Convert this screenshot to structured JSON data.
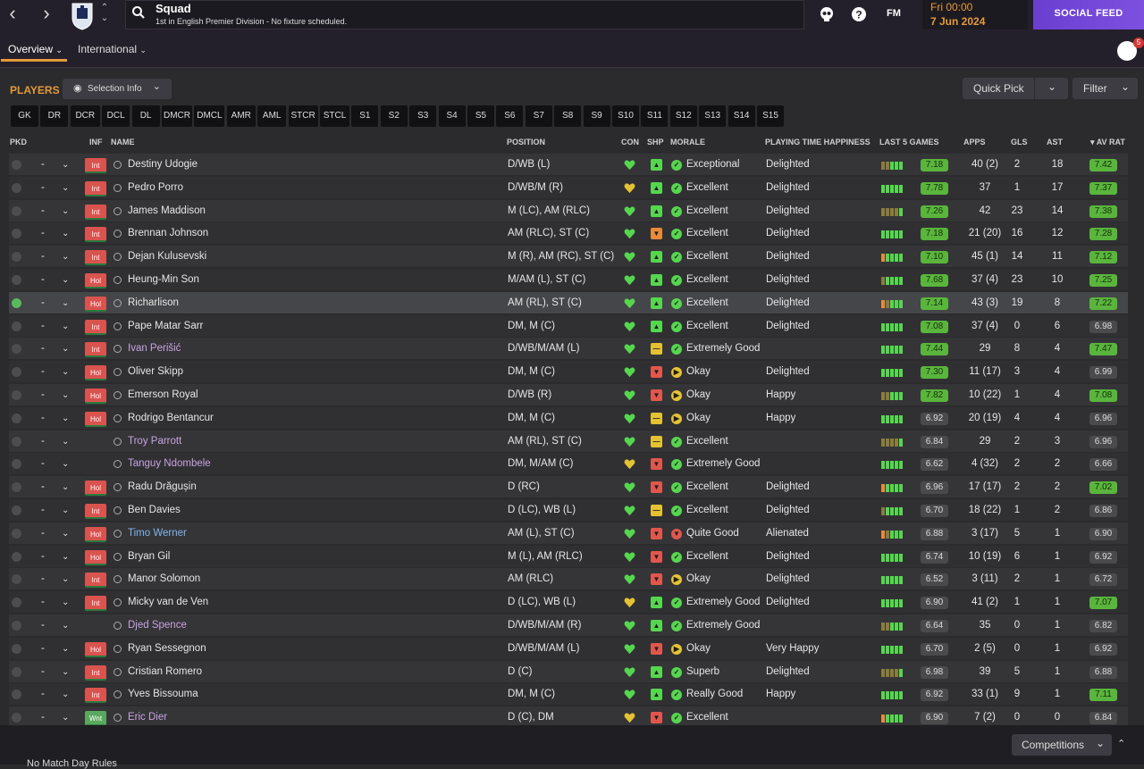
{
  "header": {
    "title": "Squad",
    "subtitle": "1st in English Premier Division - No fixture scheduled.",
    "day_time": "Fri 00:00",
    "date": "7 Jun 2024",
    "social_feed": "SOCIAL FEED",
    "fm_label": "FM",
    "notification_count": "5",
    "back": "‹",
    "forward": "›",
    "up": "⌃",
    "down": "⌄"
  },
  "subnav": {
    "overview": "Overview",
    "international": "International"
  },
  "toolbar": {
    "players_label": "PLAYERS",
    "selection_info": "Selection Info",
    "quick_pick": "Quick Pick",
    "filter": "Filter"
  },
  "position_filters": [
    "GK",
    "DR",
    "DCR",
    "DCL",
    "DL",
    "DMCR",
    "DMCL",
    "AMR",
    "AML",
    "STCR",
    "STCL",
    "S1",
    "S2",
    "S3",
    "S4",
    "S5",
    "S6",
    "S7",
    "S8",
    "S9",
    "S10",
    "S11",
    "S12",
    "S13",
    "S14",
    "S15"
  ],
  "columns": {
    "pkd": "PKD",
    "inf": "INF",
    "name": "NAME",
    "position": "POSITION",
    "con": "CON",
    "shp": "SHP",
    "morale": "MORALE",
    "pth": "PLAYING TIME HAPPINESS",
    "last5": "LAST 5 GAMES",
    "apps": "APPS",
    "gls": "GLS",
    "ast": "AST",
    "avrat": "AV RAT"
  },
  "players": [
    {
      "name": "Destiny Udogie",
      "inf": "Int",
      "pos": "D/WB (L)",
      "con": "green",
      "shp": "green",
      "morale": "Exceptional",
      "mor": "green",
      "pth": "Delighted",
      "l5": "7.18",
      "l5g": true,
      "apps": "40 (2)",
      "gls": "2",
      "ast": "18",
      "avr": "7.42",
      "avrg": true
    },
    {
      "name": "Pedro Porro",
      "inf": "Int",
      "pos": "D/WB/M (R)",
      "con": "yellow",
      "shp": "green",
      "morale": "Excellent",
      "mor": "green",
      "pth": "Delighted",
      "l5": "7.78",
      "l5g": true,
      "apps": "37",
      "gls": "1",
      "ast": "17",
      "avr": "7.37",
      "avrg": true
    },
    {
      "name": "James Maddison",
      "inf": "Int",
      "pos": "M (LC), AM (RLC)",
      "con": "green",
      "shp": "green",
      "morale": "Excellent",
      "mor": "green",
      "pth": "Delighted",
      "l5": "7.26",
      "l5g": true,
      "apps": "42",
      "gls": "23",
      "ast": "14",
      "avr": "7.38",
      "avrg": true
    },
    {
      "name": "Brennan Johnson",
      "inf": "Int",
      "pos": "AM (RLC), ST (C)",
      "con": "green",
      "shp": "orange",
      "morale": "Excellent",
      "mor": "green",
      "pth": "Delighted",
      "l5": "7.18",
      "l5g": true,
      "apps": "21 (20)",
      "gls": "16",
      "ast": "12",
      "avr": "7.28",
      "avrg": true
    },
    {
      "name": "Dejan Kulusevski",
      "inf": "Int",
      "pos": "M (R), AM (RC), ST (C)",
      "con": "green",
      "shp": "green",
      "morale": "Excellent",
      "mor": "green",
      "pth": "Delighted",
      "l5": "7.10",
      "l5g": true,
      "apps": "45 (1)",
      "gls": "14",
      "ast": "11",
      "avr": "7.12",
      "avrg": true
    },
    {
      "name": "Heung-Min Son",
      "inf": "Hol",
      "pos": "M/AM (L), ST (C)",
      "con": "green",
      "shp": "green",
      "morale": "Excellent",
      "mor": "green",
      "pth": "Delighted",
      "l5": "7.68",
      "l5g": true,
      "apps": "37 (4)",
      "gls": "23",
      "ast": "10",
      "avr": "7.25",
      "avrg": true
    },
    {
      "name": "Richarlison",
      "inf": "Hol",
      "pos": "AM (RL), ST (C)",
      "con": "green",
      "shp": "green",
      "morale": "Excellent",
      "mor": "green",
      "pth": "Delighted",
      "l5": "7.14",
      "l5g": true,
      "apps": "43 (3)",
      "gls": "19",
      "ast": "8",
      "avr": "7.22",
      "avrg": true,
      "selected": true
    },
    {
      "name": "Pape Matar Sarr",
      "inf": "Int",
      "pos": "DM, M (C)",
      "con": "green",
      "shp": "green",
      "morale": "Excellent",
      "mor": "green",
      "pth": "Delighted",
      "l5": "7.08",
      "l5g": true,
      "apps": "37 (4)",
      "gls": "0",
      "ast": "6",
      "avr": "6.98",
      "avrg": false
    },
    {
      "name": "Ivan Perišić",
      "inf": "Int",
      "pos": "D/WB/M/AM (L)",
      "con": "green",
      "shp": "yellow",
      "morale": "Extremely Good",
      "mor": "green",
      "pth": "",
      "l5": "7.44",
      "l5g": true,
      "apps": "29",
      "gls": "8",
      "ast": "4",
      "avr": "7.47",
      "avrg": true,
      "color": "purple"
    },
    {
      "name": "Oliver Skipp",
      "inf": "Hol",
      "pos": "DM, M (C)",
      "con": "green",
      "shp": "red",
      "morale": "Okay",
      "mor": "yellow",
      "pth": "Delighted",
      "l5": "7.30",
      "l5g": true,
      "apps": "11 (17)",
      "gls": "3",
      "ast": "4",
      "avr": "6.99",
      "avrg": false
    },
    {
      "name": "Emerson Royal",
      "inf": "Hol",
      "pos": "D/WB (R)",
      "con": "green",
      "shp": "red",
      "morale": "Okay",
      "mor": "yellow",
      "pth": "Happy",
      "l5": "7.82",
      "l5g": true,
      "apps": "10 (22)",
      "gls": "1",
      "ast": "4",
      "avr": "7.08",
      "avrg": true
    },
    {
      "name": "Rodrigo Bentancur",
      "inf": "Hol",
      "pos": "DM, M (C)",
      "con": "green",
      "shp": "yellow",
      "morale": "Okay",
      "mor": "yellow",
      "pth": "Happy",
      "l5": "6.92",
      "l5g": false,
      "apps": "20 (19)",
      "gls": "4",
      "ast": "4",
      "avr": "6.96",
      "avrg": false
    },
    {
      "name": "Troy Parrott",
      "inf": "",
      "pos": "AM (RL), ST (C)",
      "con": "green",
      "shp": "yellow",
      "morale": "Excellent",
      "mor": "green",
      "pth": "",
      "l5": "6.84",
      "l5g": false,
      "apps": "29",
      "gls": "2",
      "ast": "3",
      "avr": "6.96",
      "avrg": false,
      "color": "purple"
    },
    {
      "name": "Tanguy Ndombele",
      "inf": "",
      "pos": "DM, M/AM (C)",
      "con": "yellow",
      "shp": "red",
      "morale": "Extremely Good",
      "mor": "green",
      "pth": "",
      "l5": "6.62",
      "l5g": false,
      "apps": "4 (32)",
      "gls": "2",
      "ast": "2",
      "avr": "6.66",
      "avrg": false,
      "color": "purple"
    },
    {
      "name": "Radu Drăgușin",
      "inf": "Hol",
      "pos": "D (RC)",
      "con": "green",
      "shp": "red",
      "morale": "Excellent",
      "mor": "green",
      "pth": "Delighted",
      "l5": "6.96",
      "l5g": false,
      "apps": "17 (17)",
      "gls": "2",
      "ast": "2",
      "avr": "7.02",
      "avrg": true
    },
    {
      "name": "Ben Davies",
      "inf": "Int",
      "pos": "D (LC), WB (L)",
      "con": "green",
      "shp": "yellow",
      "morale": "Excellent",
      "mor": "green",
      "pth": "Delighted",
      "l5": "6.70",
      "l5g": false,
      "apps": "18 (22)",
      "gls": "1",
      "ast": "2",
      "avr": "6.86",
      "avrg": false
    },
    {
      "name": "Timo Werner",
      "inf": "Hol",
      "pos": "AM (L), ST (C)",
      "con": "green",
      "shp": "red",
      "morale": "Quite Good",
      "mor": "red",
      "pth": "Alienated",
      "l5": "6.88",
      "l5g": false,
      "apps": "3 (17)",
      "gls": "5",
      "ast": "1",
      "avr": "6.90",
      "avrg": false,
      "color": "blue"
    },
    {
      "name": "Bryan Gil",
      "inf": "Hol",
      "pos": "M (L), AM (RLC)",
      "con": "green",
      "shp": "red",
      "morale": "Excellent",
      "mor": "green",
      "pth": "Delighted",
      "l5": "6.74",
      "l5g": false,
      "apps": "10 (19)",
      "gls": "6",
      "ast": "1",
      "avr": "6.92",
      "avrg": false
    },
    {
      "name": "Manor Solomon",
      "inf": "Int",
      "pos": "AM (RLC)",
      "con": "green",
      "shp": "red",
      "morale": "Okay",
      "mor": "yellow",
      "pth": "Delighted",
      "l5": "6.52",
      "l5g": false,
      "apps": "3 (11)",
      "gls": "2",
      "ast": "1",
      "avr": "6.72",
      "avrg": false
    },
    {
      "name": "Micky van de Ven",
      "inf": "Int",
      "pos": "D (LC), WB (L)",
      "con": "yellow",
      "shp": "green",
      "morale": "Extremely Good",
      "mor": "green",
      "pth": "Delighted",
      "l5": "6.90",
      "l5g": false,
      "apps": "41 (2)",
      "gls": "1",
      "ast": "1",
      "avr": "7.07",
      "avrg": true
    },
    {
      "name": "Djed Spence",
      "inf": "",
      "pos": "D/WB/M/AM (R)",
      "con": "green",
      "shp": "green",
      "morale": "Extremely Good",
      "mor": "green",
      "pth": "",
      "l5": "6.64",
      "l5g": false,
      "apps": "35",
      "gls": "0",
      "ast": "1",
      "avr": "6.82",
      "avrg": false,
      "color": "purple"
    },
    {
      "name": "Ryan Sessegnon",
      "inf": "Hol",
      "pos": "D/WB/M/AM (L)",
      "con": "green",
      "shp": "red",
      "morale": "Okay",
      "mor": "yellow",
      "pth": "Very Happy",
      "l5": "6.70",
      "l5g": false,
      "apps": "2 (5)",
      "gls": "0",
      "ast": "1",
      "avr": "6.92",
      "avrg": false
    },
    {
      "name": "Cristian Romero",
      "inf": "Int",
      "pos": "D (C)",
      "con": "green",
      "shp": "green",
      "morale": "Superb",
      "mor": "green",
      "pth": "Delighted",
      "l5": "6.98",
      "l5g": false,
      "apps": "39",
      "gls": "5",
      "ast": "1",
      "avr": "6.88",
      "avrg": false
    },
    {
      "name": "Yves Bissouma",
      "inf": "Int",
      "pos": "DM, M (C)",
      "con": "green",
      "shp": "green",
      "morale": "Really Good",
      "mor": "green",
      "pth": "Happy",
      "l5": "6.92",
      "l5g": false,
      "apps": "33 (1)",
      "gls": "9",
      "ast": "1",
      "avr": "7.11",
      "avrg": true
    },
    {
      "name": "Eric Dier",
      "inf": "Wnt",
      "pos": "D (C), DM",
      "con": "yellow",
      "shp": "red",
      "morale": "Excellent",
      "mor": "green",
      "pth": "",
      "l5": "6.90",
      "l5g": false,
      "apps": "7 (2)",
      "gls": "0",
      "ast": "0",
      "avr": "6.84",
      "avrg": false,
      "color": "purple"
    }
  ],
  "footer": {
    "competitions": "Competitions",
    "note": "No Match Day Rules"
  }
}
